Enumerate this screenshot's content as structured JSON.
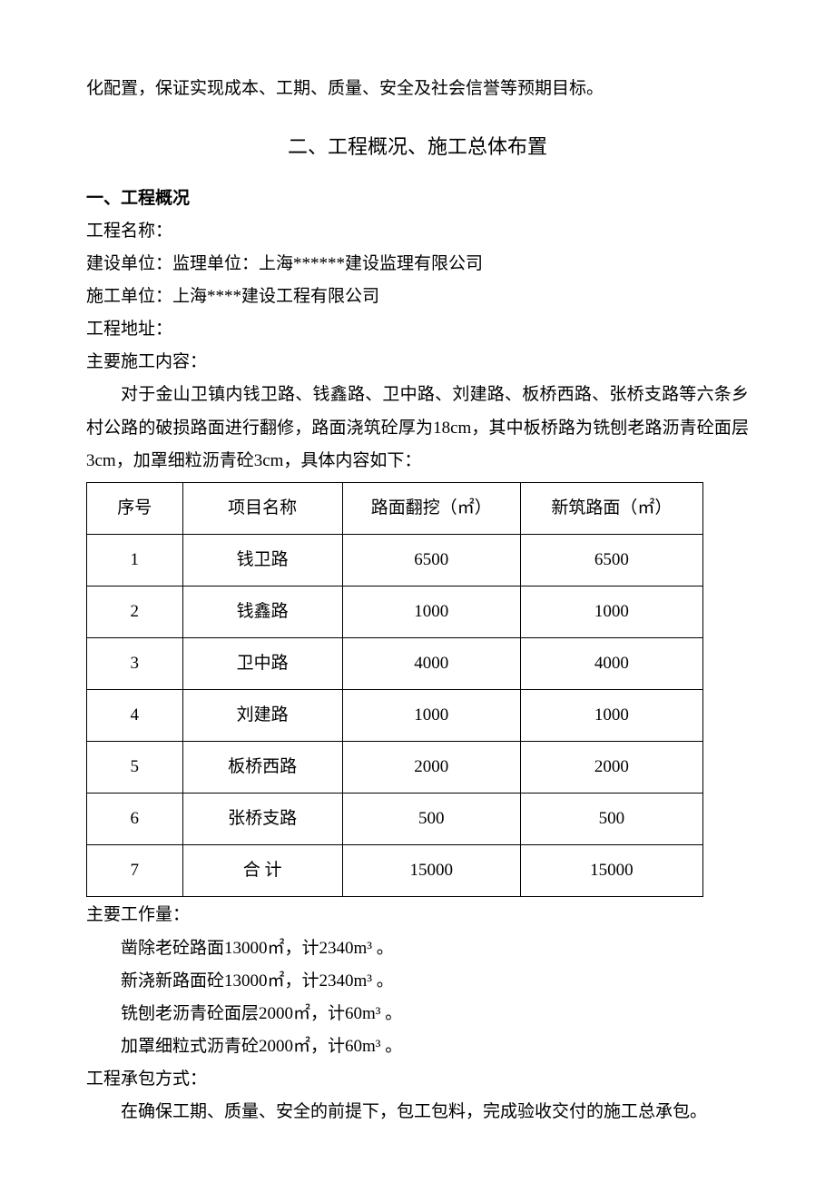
{
  "intro_fragment": "化配置，保证实现成本、工期、质量、安全及社会信誉等预期目标。",
  "section_heading": "二、工程概况、施工总体布置",
  "sub1_heading": "一、工程概况",
  "fields": {
    "name_label": "工程名称：",
    "builder_label": "建设单位：监理单位：上海******建设监理有限公司",
    "contractor_label": "施工单位：上海****建设工程有限公司",
    "address_label": "工程地址：",
    "content_label": "主要施工内容：",
    "content_para": "对于金山卫镇内钱卫路、钱鑫路、卫中路、刘建路、板桥西路、张桥支路等六条乡村公路的破损路面进行翻修，路面浇筑砼厚为18cm，其中板桥路为铣刨老路沥青砼面层3cm，加罩细粒沥青砼3cm，具体内容如下："
  },
  "chart_data": {
    "type": "table",
    "headers": [
      "序号",
      "项目名称",
      "路面翻挖（㎡）",
      "新筑路面（㎡）"
    ],
    "rows": [
      [
        "1",
        "钱卫路",
        "6500",
        "6500"
      ],
      [
        "2",
        "钱鑫路",
        "1000",
        "1000"
      ],
      [
        "3",
        "卫中路",
        "4000",
        "4000"
      ],
      [
        "4",
        "刘建路",
        "1000",
        "1000"
      ],
      [
        "5",
        "板桥西路",
        "2000",
        "2000"
      ],
      [
        "6",
        "张桥支路",
        "500",
        "500"
      ],
      [
        "7",
        "合 计",
        "15000",
        "15000"
      ]
    ]
  },
  "workload": {
    "label": "主要工作量：",
    "items": [
      "凿除老砼路面13000㎡，计2340m³ 。",
      "新浇新路面砼13000㎡，计2340m³ 。",
      "铣刨老沥青砼面层2000㎡，计60m³ 。",
      "加罩细粒式沥青砼2000㎡，计60m³ 。"
    ]
  },
  "contract": {
    "label": "工程承包方式：",
    "text": "在确保工期、质量、安全的前提下，包工包料，完成验收交付的施工总承包。"
  }
}
